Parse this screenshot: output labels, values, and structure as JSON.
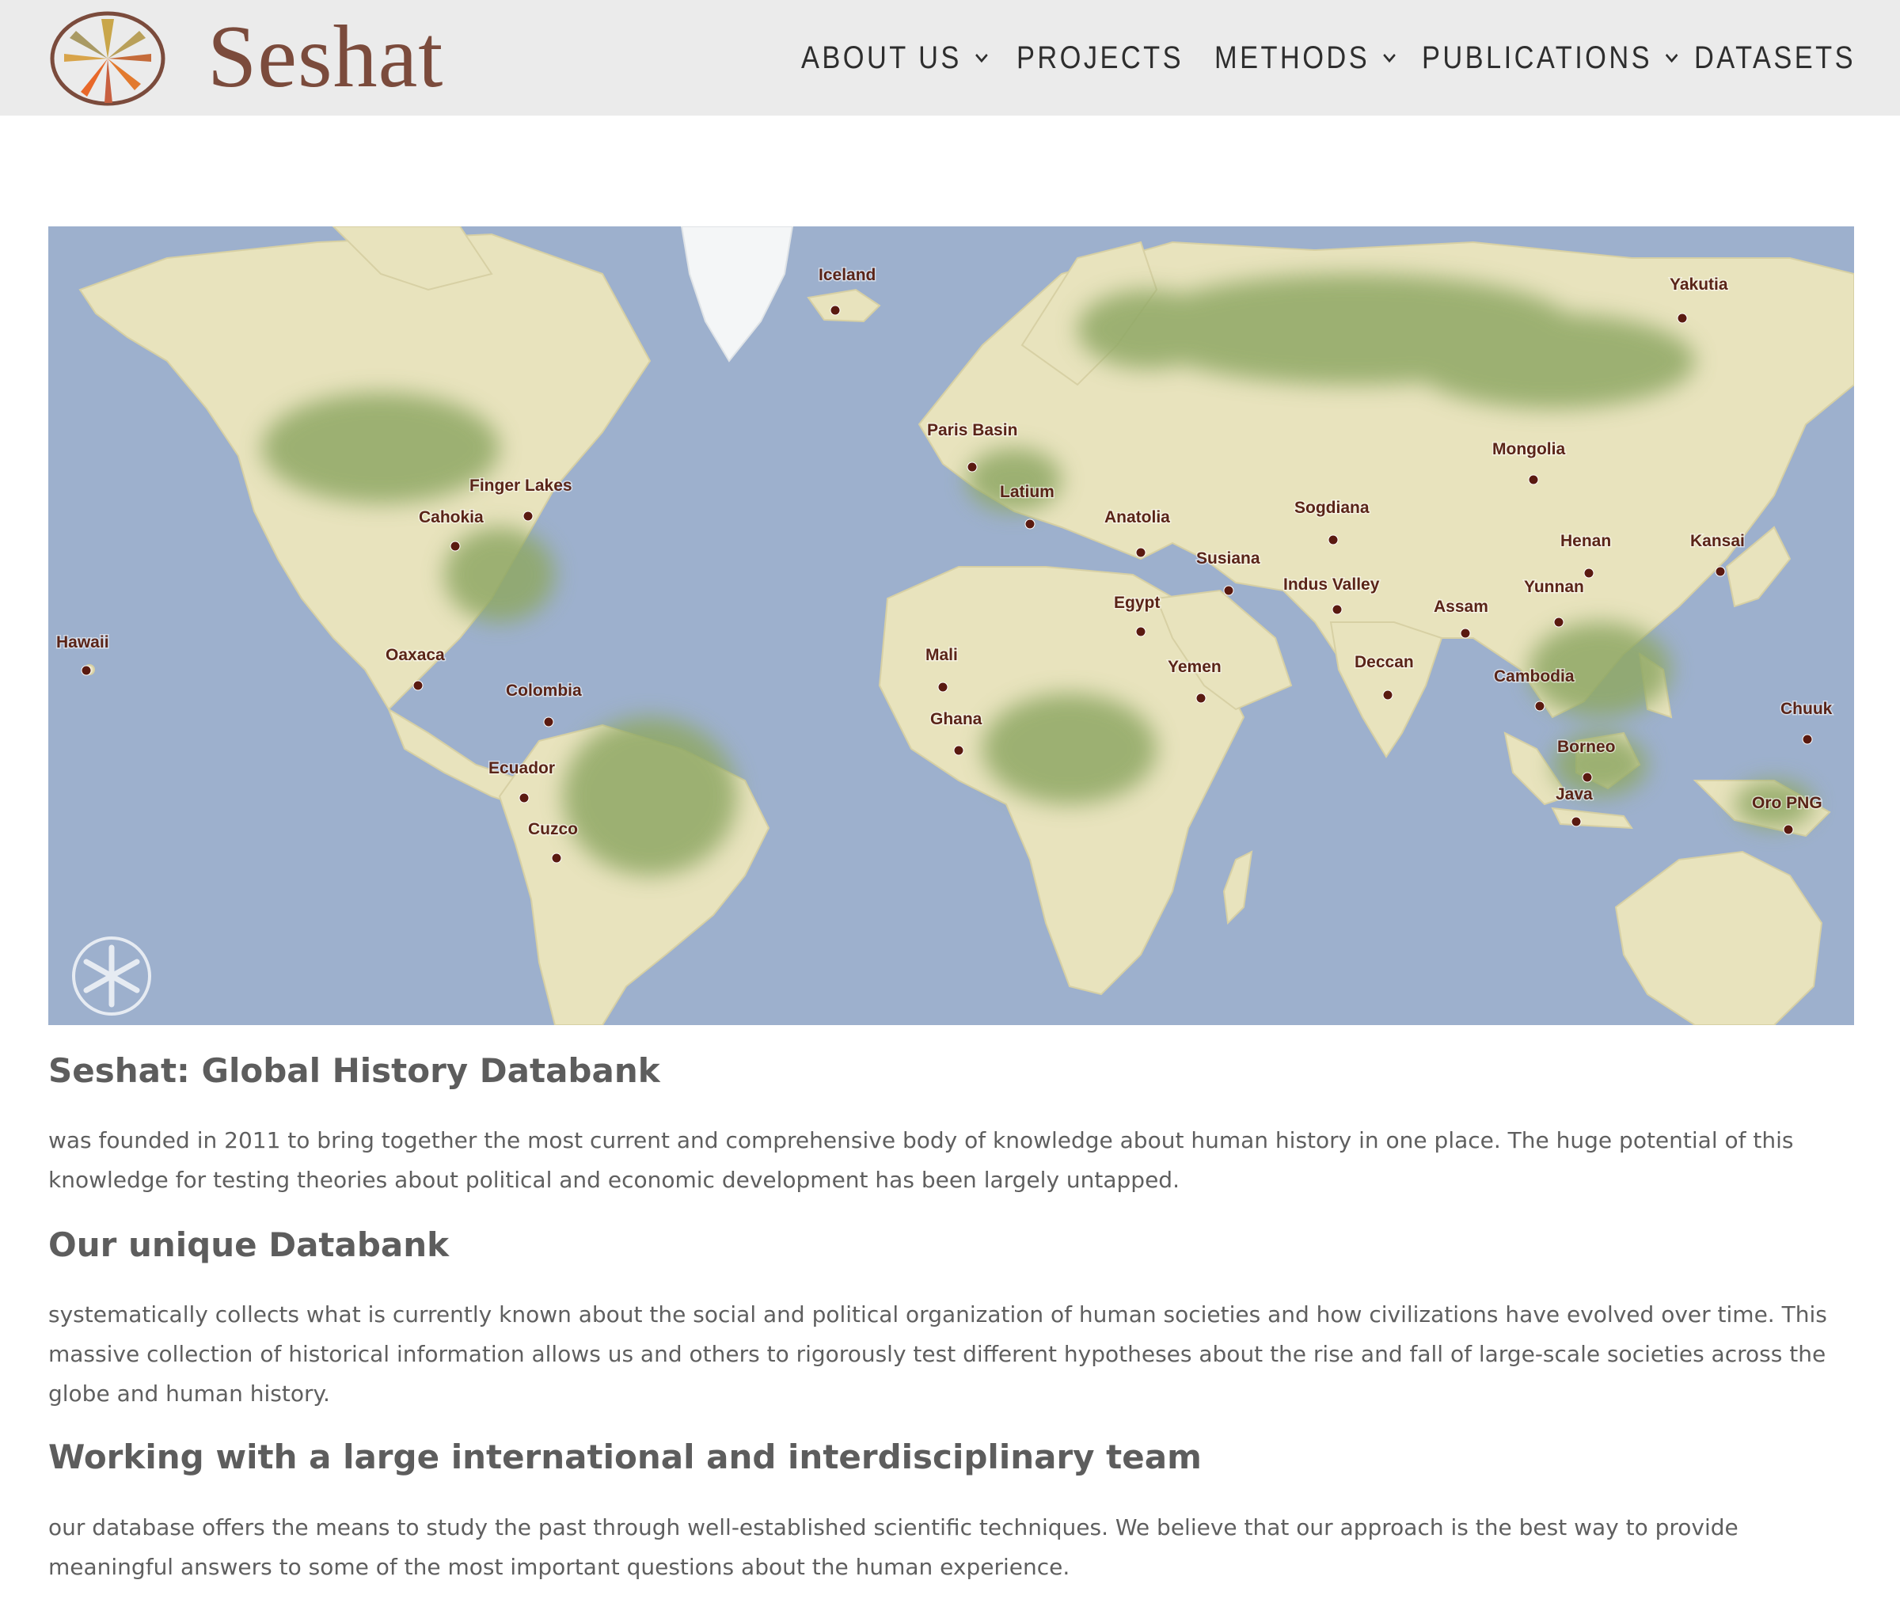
{
  "brand": {
    "name": "Seshat"
  },
  "nav": {
    "items": [
      {
        "label": "ABOUT US",
        "has_dropdown": true
      },
      {
        "label": "PROJECTS",
        "has_dropdown": false
      },
      {
        "label": "METHODS",
        "has_dropdown": true
      },
      {
        "label": "PUBLICATIONS",
        "has_dropdown": true
      },
      {
        "label": "DATASETS",
        "has_dropdown": false
      }
    ]
  },
  "map": {
    "locations": [
      "Iceland",
      "Yakutia",
      "Paris Basin",
      "Mongolia",
      "Finger Lakes",
      "Latium",
      "Cahokia",
      "Anatolia",
      "Sogdiana",
      "Henan",
      "Kansai",
      "Susiana",
      "Indus Valley",
      "Yunnan",
      "Egypt",
      "Assam",
      "Hawaii",
      "Mali",
      "Oaxaca",
      "Yemen",
      "Deccan",
      "Cambodia",
      "Colombia",
      "Chuuk",
      "Ghana",
      "Borneo",
      "Ecuador",
      "Java",
      "Oro PNG",
      "Cuzco"
    ]
  },
  "content": {
    "heading1": "Seshat: Global History Databank",
    "paragraph1": "was founded in 2011 to bring together the most current and comprehensive body of knowledge about human history in one place. The huge potential of this knowledge for testing theories about political and economic development has been largely untapped.",
    "heading2": "Our unique Databank",
    "paragraph2": "systematically collects what is currently known about the social and political organization of human societies and how civilizations have evolved over time. This massive collection of historical information allows us and others to rigorously test different hypotheses about the rise and fall of large-scale societies across the globe and human history.",
    "heading3": "Working with a large international and interdisciplinary team",
    "paragraph3": "our database offers the means to study the past through well-established scientific techniques. We believe that our approach is the best way to provide meaningful answers to some of the most important questions about the human experience."
  },
  "colors": {
    "brand": "#7b4b3c",
    "header_bg": "#ebebeb",
    "ocean": "#9db0cd",
    "land": "#e8e3bd",
    "forest": "#8fa865",
    "marker": "#5a1a10"
  }
}
